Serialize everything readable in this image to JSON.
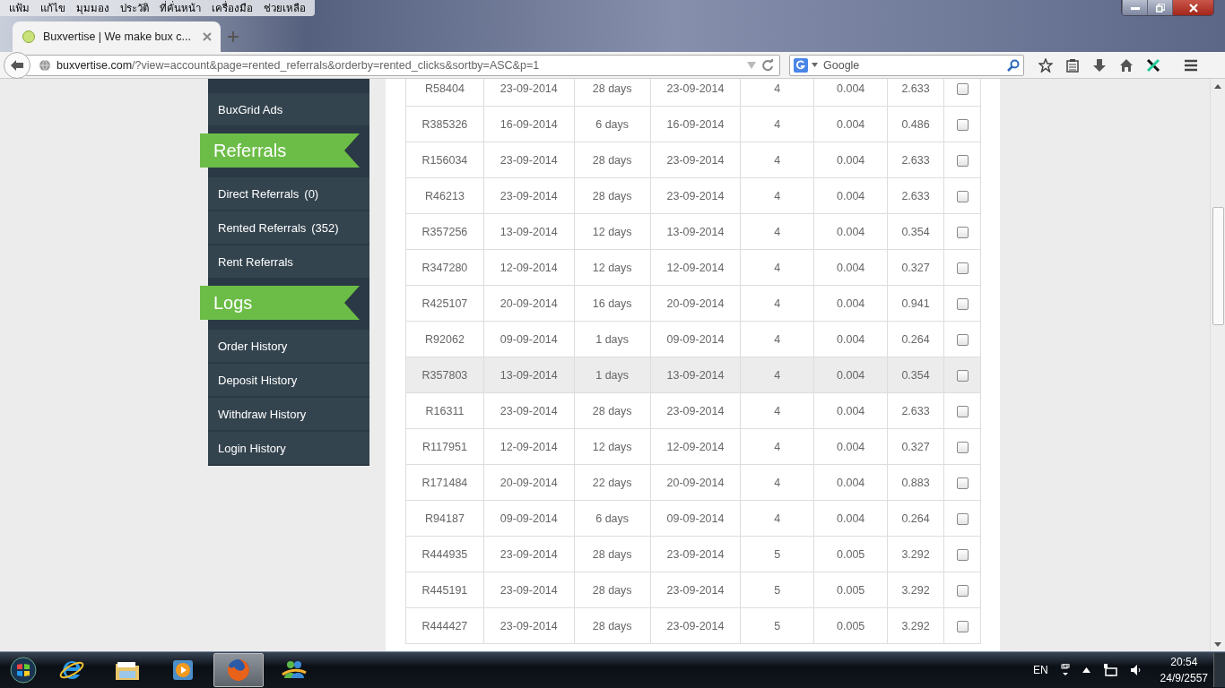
{
  "menu": [
    "แฟ้ม",
    "แก้ไข",
    "มุมมอง",
    "ประวัติ",
    "ที่คั่นหน้า",
    "เครื่องมือ",
    "ช่วยเหลือ"
  ],
  "tabs": [
    {
      "title": "Buxvertise | We make bux c...",
      "selected": true
    }
  ],
  "address": {
    "domain": "buxvertise.com",
    "path": "/?view=account&page=rented_referrals&orderby=rented_clicks&sortby=ASC&p=1"
  },
  "search": {
    "placeholder": "Google"
  },
  "sidebar": [
    {
      "kind": "item",
      "label": "BuxGrid Ads"
    },
    {
      "kind": "header",
      "label": "Referrals"
    },
    {
      "kind": "item",
      "label": "Direct Referrals",
      "count": "(0)"
    },
    {
      "kind": "item",
      "label": "Rented Referrals",
      "count": "(352)"
    },
    {
      "kind": "item",
      "label": "Rent Referrals"
    },
    {
      "kind": "header",
      "label": "Logs"
    },
    {
      "kind": "item",
      "label": "Order History"
    },
    {
      "kind": "item",
      "label": "Deposit History"
    },
    {
      "kind": "item",
      "label": "Withdraw History"
    },
    {
      "kind": "item",
      "label": "Login History"
    }
  ],
  "table": {
    "rows": [
      {
        "cells": [
          "R58404",
          "23-09-2014",
          "28 days",
          "23-09-2014",
          "4",
          "0.004",
          "2.633"
        ],
        "checked": false,
        "hovered": false
      },
      {
        "cells": [
          "R385326",
          "16-09-2014",
          "6 days",
          "16-09-2014",
          "4",
          "0.004",
          "0.486"
        ],
        "checked": false,
        "hovered": false
      },
      {
        "cells": [
          "R156034",
          "23-09-2014",
          "28 days",
          "23-09-2014",
          "4",
          "0.004",
          "2.633"
        ],
        "checked": false,
        "hovered": false
      },
      {
        "cells": [
          "R46213",
          "23-09-2014",
          "28 days",
          "23-09-2014",
          "4",
          "0.004",
          "2.633"
        ],
        "checked": false,
        "hovered": false
      },
      {
        "cells": [
          "R357256",
          "13-09-2014",
          "12 days",
          "13-09-2014",
          "4",
          "0.004",
          "0.354"
        ],
        "checked": false,
        "hovered": false
      },
      {
        "cells": [
          "R347280",
          "12-09-2014",
          "12 days",
          "12-09-2014",
          "4",
          "0.004",
          "0.327"
        ],
        "checked": false,
        "hovered": false
      },
      {
        "cells": [
          "R425107",
          "20-09-2014",
          "16 days",
          "20-09-2014",
          "4",
          "0.004",
          "0.941"
        ],
        "checked": false,
        "hovered": false
      },
      {
        "cells": [
          "R92062",
          "09-09-2014",
          "1 days",
          "09-09-2014",
          "4",
          "0.004",
          "0.264"
        ],
        "checked": false,
        "hovered": false
      },
      {
        "cells": [
          "R357803",
          "13-09-2014",
          "1 days",
          "13-09-2014",
          "4",
          "0.004",
          "0.354"
        ],
        "checked": false,
        "hovered": true
      },
      {
        "cells": [
          "R16311",
          "23-09-2014",
          "28 days",
          "23-09-2014",
          "4",
          "0.004",
          "2.633"
        ],
        "checked": false,
        "hovered": false
      },
      {
        "cells": [
          "R117951",
          "12-09-2014",
          "12 days",
          "12-09-2014",
          "4",
          "0.004",
          "0.327"
        ],
        "checked": false,
        "hovered": false
      },
      {
        "cells": [
          "R171484",
          "20-09-2014",
          "22 days",
          "20-09-2014",
          "4",
          "0.004",
          "0.883"
        ],
        "checked": false,
        "hovered": false
      },
      {
        "cells": [
          "R94187",
          "09-09-2014",
          "6 days",
          "09-09-2014",
          "4",
          "0.004",
          "0.264"
        ],
        "checked": false,
        "hovered": false
      },
      {
        "cells": [
          "R444935",
          "23-09-2014",
          "28 days",
          "23-09-2014",
          "5",
          "0.005",
          "3.292"
        ],
        "checked": false,
        "hovered": false
      },
      {
        "cells": [
          "R445191",
          "23-09-2014",
          "28 days",
          "23-09-2014",
          "5",
          "0.005",
          "3.292"
        ],
        "checked": false,
        "hovered": false
      },
      {
        "cells": [
          "R444427",
          "23-09-2014",
          "28 days",
          "23-09-2014",
          "5",
          "0.005",
          "3.292"
        ],
        "checked": false,
        "hovered": false
      }
    ]
  },
  "taskbar": {
    "apps": [
      {
        "kind": "ie",
        "selected": false
      },
      {
        "kind": "folder",
        "selected": false
      },
      {
        "kind": "media",
        "selected": false
      },
      {
        "kind": "firefox",
        "selected": true
      },
      {
        "kind": "messenger",
        "selected": false
      }
    ],
    "language": "EN",
    "time": "20:54",
    "date": "24/9/2557"
  }
}
